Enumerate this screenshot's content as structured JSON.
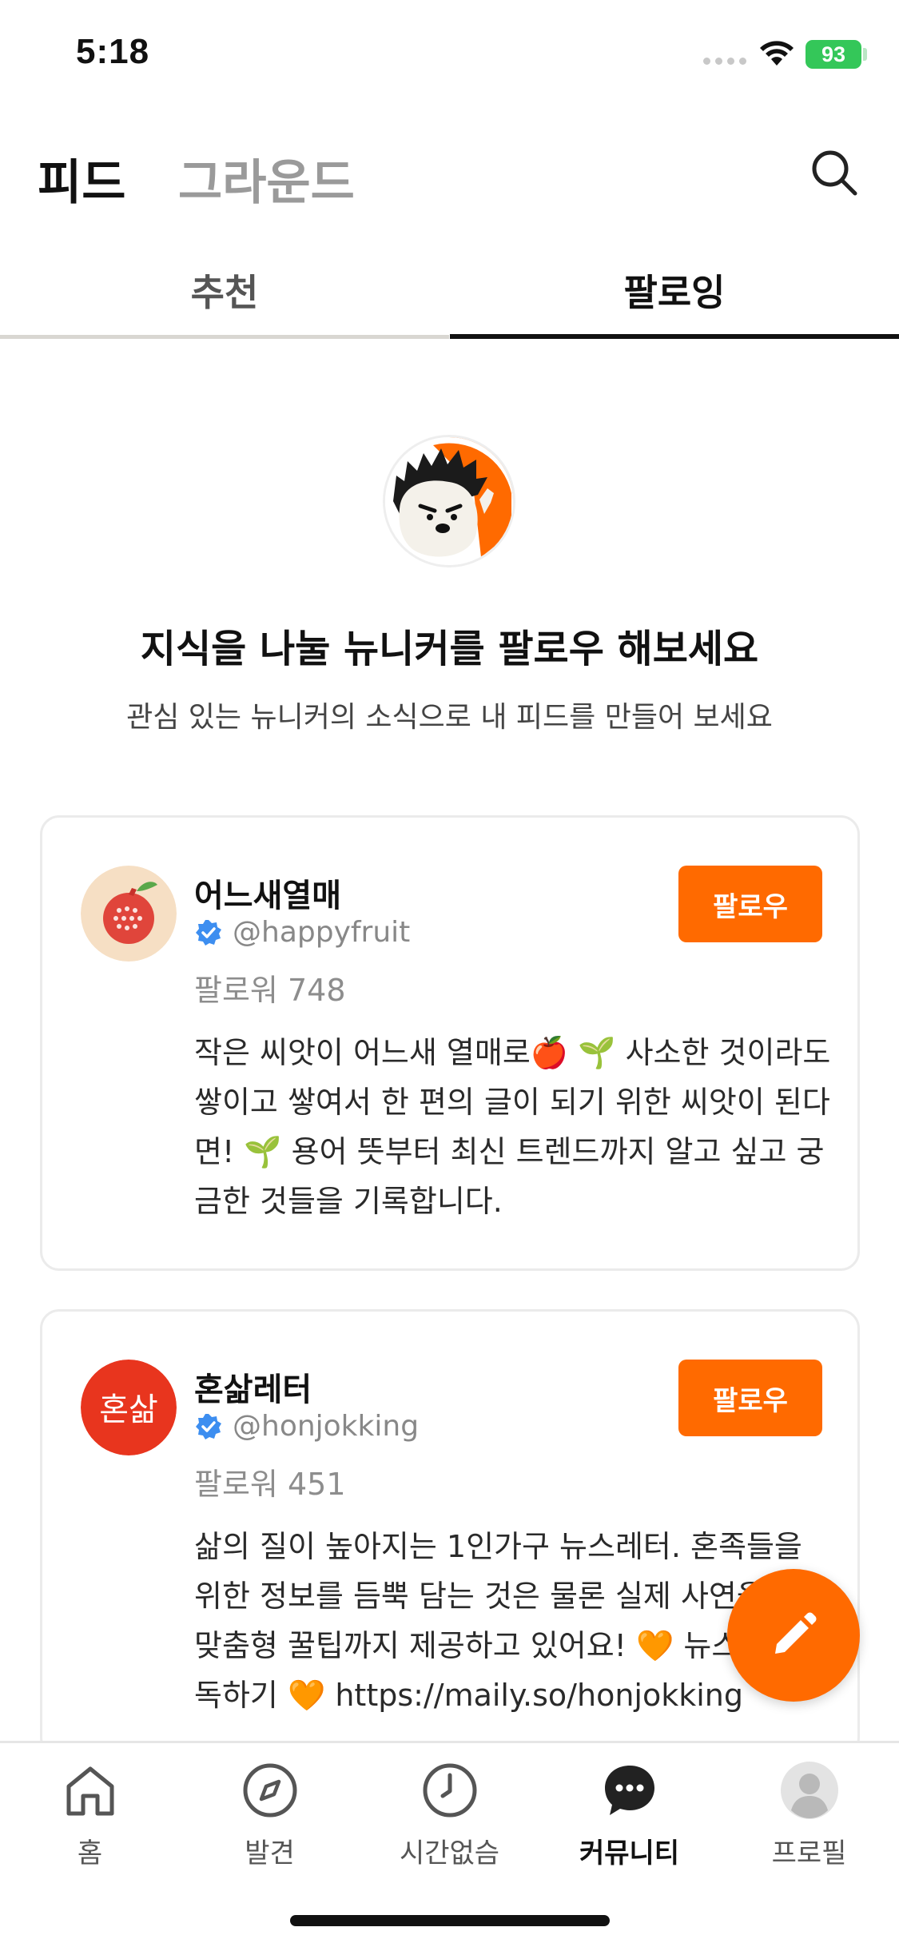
{
  "status_bar": {
    "time": "5:18",
    "battery": "93"
  },
  "header": {
    "tabs": [
      {
        "label": "피드",
        "active": true
      },
      {
        "label": "그라운드",
        "active": false
      }
    ],
    "search_icon": "search-icon"
  },
  "sub_tabs": [
    {
      "label": "추천",
      "active": false
    },
    {
      "label": "팔로잉",
      "active": true
    }
  ],
  "hero": {
    "title": "지식을 나눌 뉴니커를 팔로우 해보세요",
    "subtitle": "관심 있는 뉴니커의 소식으로 내 피드를 만들어 보세요"
  },
  "cards": [
    {
      "name": "어느새열매",
      "handle": "@happyfruit",
      "followers": "팔로워 748",
      "bio": "작은 씨앗이 어느새 열매로🍎 🌱 사소한 것이라도 쌓이고 쌓여서 한 편의 글이 되기 위한 씨앗이 된다면! 🌱 용어 뜻부터 최신 트렌드까지 알고 싶고 궁금한 것들을 기록합니다.",
      "button": "팔로우"
    },
    {
      "name": "혼삶레터",
      "handle": "@honjokking",
      "followers": "팔로워 451",
      "bio": "삶의 질이 높아지는 1인가구 뉴스레터. 혼족들을 위한 정보를 듬뿍 담는 것은 물론 실제 사연을 받아 맞춤형 꿀팁까지 제공하고 있어요! 🧡 뉴스레터 구독하기 🧡 https://maily.so/honjokking",
      "button": "팔로우",
      "avatar_text": "혼삶"
    }
  ],
  "fab_icon": "pencil-icon",
  "bottom_nav": [
    {
      "label": "홈",
      "icon": "home-icon",
      "active": false
    },
    {
      "label": "발견",
      "icon": "compass-icon",
      "active": false
    },
    {
      "label": "시간없슴",
      "icon": "clock-icon",
      "active": false
    },
    {
      "label": "커뮤니티",
      "icon": "chat-bubble-icon",
      "active": true
    },
    {
      "label": "프로필",
      "icon": "profile-avatar-icon",
      "active": false
    }
  ],
  "colors": {
    "accent": "#ff6a00",
    "verified": "#3d8ef0",
    "battery": "#34c759"
  }
}
